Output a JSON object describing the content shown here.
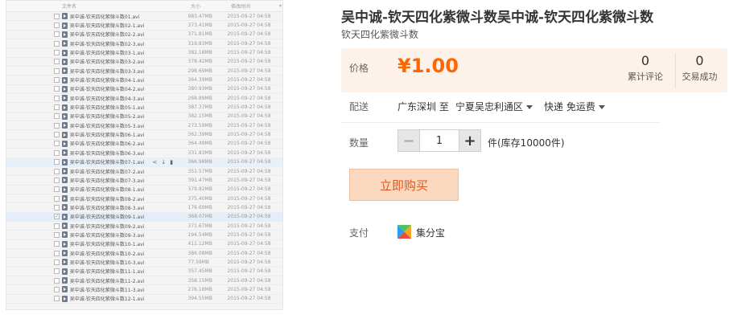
{
  "file_list": {
    "header": {
      "name": "文件名",
      "size": "大小",
      "time": "修改时间"
    },
    "rows": [
      {
        "name": "吴中诚-钦天四化紫微斗数01.avi",
        "size": "983.47MB",
        "time": "2015-09-27 04:58"
      },
      {
        "name": "吴中诚-钦天四化紫微斗数02-1.avi",
        "size": "373.41MB",
        "time": "2015-09-27 04:58"
      },
      {
        "name": "吴中诚-钦天四化紫微斗数02-2.avi",
        "size": "371.81MB",
        "time": "2015-09-27 04:58"
      },
      {
        "name": "吴中诚-钦天四化紫微斗数02-3.avi",
        "size": "319.83MB",
        "time": "2015-09-27 04:58"
      },
      {
        "name": "吴中诚-钦天四化紫微斗数03-1.avi",
        "size": "382.18MB",
        "time": "2015-09-27 04:58"
      },
      {
        "name": "吴中诚-钦天四化紫微斗数03-2.avi",
        "size": "378.42MB",
        "time": "2015-09-27 04:58"
      },
      {
        "name": "吴中诚-钦天四化紫微斗数03-3.avi",
        "size": "298.69MB",
        "time": "2015-09-27 04:58"
      },
      {
        "name": "吴中诚-钦天四化紫微斗数04-1.avi",
        "size": "364.39MB",
        "time": "2015-09-27 04:58"
      },
      {
        "name": "吴中诚-钦天四化紫微斗数04-2.avi",
        "size": "380.93MB",
        "time": "2015-09-27 04:58"
      },
      {
        "name": "吴中诚-钦天四化紫微斗数04-3.avi",
        "size": "268.89MB",
        "time": "2015-09-27 04:58"
      },
      {
        "name": "吴中诚-钦天四化紫微斗数05-1.avi",
        "size": "387.37MB",
        "time": "2015-09-27 04:58"
      },
      {
        "name": "吴中诚-钦天四化紫微斗数05-2.avi",
        "size": "382.15MB",
        "time": "2015-09-27 04:58"
      },
      {
        "name": "吴中诚-钦天四化紫微斗数05-3.avi",
        "size": "273.59MB",
        "time": "2015-09-27 04:58"
      },
      {
        "name": "吴中诚-钦天四化紫微斗数06-1.avi",
        "size": "362.39MB",
        "time": "2015-09-27 04:58"
      },
      {
        "name": "吴中诚-钦天四化紫微斗数06-2.avi",
        "size": "364.49MB",
        "time": "2015-09-27 04:58"
      },
      {
        "name": "吴中诚-钦天四化紫微斗数06-3.avi",
        "size": "331.83MB",
        "time": "2015-09-27 04:58"
      },
      {
        "name": "吴中诚-钦天四化紫微斗数07-1.avi",
        "size": "366.98MB",
        "time": "2015-09-27 04:58",
        "hover": true
      },
      {
        "name": "吴中诚-钦天四化紫微斗数07-2.avi",
        "size": "351.57MB",
        "time": "2015-09-27 04:58"
      },
      {
        "name": "吴中诚-钦天四化紫微斗数07-3.avi",
        "size": "391.47MB",
        "time": "2015-09-27 04:58"
      },
      {
        "name": "吴中诚-钦天四化紫微斗数08-1.avi",
        "size": "379.82MB",
        "time": "2015-09-27 04:58"
      },
      {
        "name": "吴中诚-钦天四化紫微斗数08-2.avi",
        "size": "375.40MB",
        "time": "2015-09-27 04:58"
      },
      {
        "name": "吴中诚-钦天四化紫微斗数08-3.avi",
        "size": "176.69MB",
        "time": "2015-09-27 04:58"
      },
      {
        "name": "吴中诚-钦天四化紫微斗数09-1.avi",
        "size": "368.07MB",
        "time": "2015-09-27 04:58",
        "selected": true
      },
      {
        "name": "吴中诚-钦天四化紫微斗数09-2.avi",
        "size": "371.67MB",
        "time": "2015-09-27 04:58"
      },
      {
        "name": "吴中诚-钦天四化紫微斗数09-3.avi",
        "size": "194.54MB",
        "time": "2015-09-27 04:58"
      },
      {
        "name": "吴中诚-钦天四化紫微斗数10-1.avi",
        "size": "411.12MB",
        "time": "2015-09-27 04:58"
      },
      {
        "name": "吴中诚-钦天四化紫微斗数10-2.avi",
        "size": "386.08MB",
        "time": "2015-09-27 04:58"
      },
      {
        "name": "吴中诚-钦天四化紫微斗数10-3.avi",
        "size": "77.59MB",
        "time": "2015-09-27 04:58"
      },
      {
        "name": "吴中诚-钦天四化紫微斗数11-1.avi",
        "size": "357.45MB",
        "time": "2015-09-27 04:58"
      },
      {
        "name": "吴中诚-钦天四化紫微斗数11-2.avi",
        "size": "358.15MB",
        "time": "2015-09-27 04:58"
      },
      {
        "name": "吴中诚-钦天四化紫微斗数11-3.avi",
        "size": "276.18MB",
        "time": "2015-09-27 04:58"
      },
      {
        "name": "吴中诚-钦天四化紫微斗数12-1.avi",
        "size": "394.55MB",
        "time": "2015-09-27 04:58"
      }
    ],
    "row_actions": [
      "share-icon",
      "download-icon",
      "delete-icon"
    ]
  },
  "product": {
    "title": "吴中诚-钦天四化紫微斗数吴中诚-钦天四化紫微斗数",
    "subtitle": "钦天四化紫微斗数",
    "price_label": "价格",
    "price": "¥1.00",
    "reviews_count": "0",
    "reviews_label": "累计评论",
    "sales_count": "0",
    "sales_label": "交易成功",
    "shipping_label": "配送",
    "ship_from": "广东深圳 至",
    "ship_to": "宁夏吴忠利通区",
    "ship_method": "快递 免运费",
    "qty_label": "数量",
    "qty_minus": "−",
    "qty_value": "1",
    "qty_plus": "+",
    "stock": "件(库存10000件)",
    "buy_label": "立即购买",
    "pay_label": "支付",
    "pay_method": "集分宝"
  },
  "colors": {
    "price": "#ff6600",
    "price_bg": "#fdf2ea",
    "buy_bg": "#fbd8c0",
    "buy_text": "#e0561f"
  }
}
